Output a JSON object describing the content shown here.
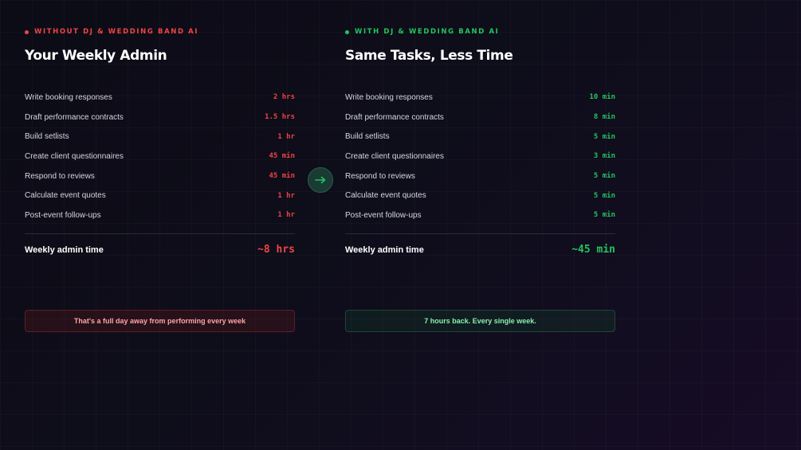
{
  "without": {
    "eyebrow": "WITHOUT DJ & WEDDING BAND AI",
    "title": "Your Weekly Admin",
    "tasks": [
      {
        "label": "Write booking responses",
        "time": "2 hrs"
      },
      {
        "label": "Draft performance contracts",
        "time": "1.5 hrs"
      },
      {
        "label": "Build setlists",
        "time": "1 hr"
      },
      {
        "label": "Create client questionnaires",
        "time": "45 min"
      },
      {
        "label": "Respond to reviews",
        "time": "45 min"
      },
      {
        "label": "Calculate event quotes",
        "time": "1 hr"
      },
      {
        "label": "Post-event follow-ups",
        "time": "1 hr"
      }
    ],
    "total_label": "Weekly admin time",
    "total_value": "~8 hrs",
    "callout": "That's a full day away from performing every week"
  },
  "with": {
    "eyebrow": "WITH DJ & WEDDING BAND AI",
    "title": "Same Tasks, Less Time",
    "tasks": [
      {
        "label": "Write booking responses",
        "time": "10 min"
      },
      {
        "label": "Draft performance contracts",
        "time": "8 min"
      },
      {
        "label": "Build setlists",
        "time": "5 min"
      },
      {
        "label": "Create client questionnaires",
        "time": "3 min"
      },
      {
        "label": "Respond to reviews",
        "time": "5 min"
      },
      {
        "label": "Calculate event quotes",
        "time": "5 min"
      },
      {
        "label": "Post-event follow-ups",
        "time": "5 min"
      }
    ],
    "total_label": "Weekly admin time",
    "total_value": "~45 min",
    "callout": "7 hours back. Every single week."
  },
  "icons": {
    "divider_arrow": "arrow-right-icon",
    "status_dot": "dot-icon"
  },
  "colors": {
    "negative": "#ef4444",
    "positive": "#22c55e"
  }
}
